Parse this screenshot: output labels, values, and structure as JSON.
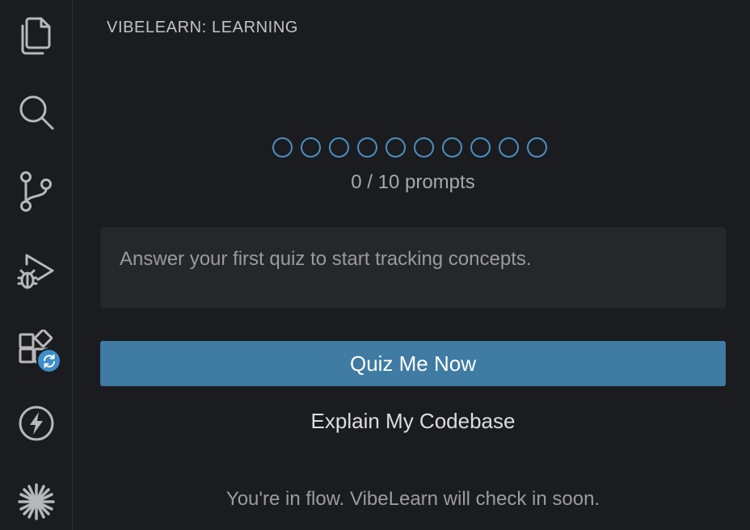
{
  "activity_bar": {
    "items": [
      {
        "icon": "files-icon"
      },
      {
        "icon": "search-icon"
      },
      {
        "icon": "source-control-icon"
      },
      {
        "icon": "run-debug-icon"
      },
      {
        "icon": "extensions-icon",
        "badge_icon": "sync-icon"
      },
      {
        "icon": "vibelearn-bolt-icon"
      },
      {
        "icon": "sparkle-icon"
      }
    ],
    "colors": {
      "icon": "#b7b8bb",
      "badge": "#3f8ec7"
    }
  },
  "panel": {
    "title": "VIBELEARN: LEARNING",
    "progress": {
      "completed": 0,
      "total": 10,
      "label": "0 / 10 prompts"
    },
    "concepts_message": "Answer your first quiz to start tracking concepts.",
    "quiz_button_label": "Quiz Me Now",
    "explain_link_label": "Explain My Codebase",
    "flow_status": "You're in flow. VibeLearn will check in soon."
  },
  "colors": {
    "background": "#1b1c1f",
    "accent": "#3f7ba3",
    "dot_outline": "#4b8fc0"
  }
}
